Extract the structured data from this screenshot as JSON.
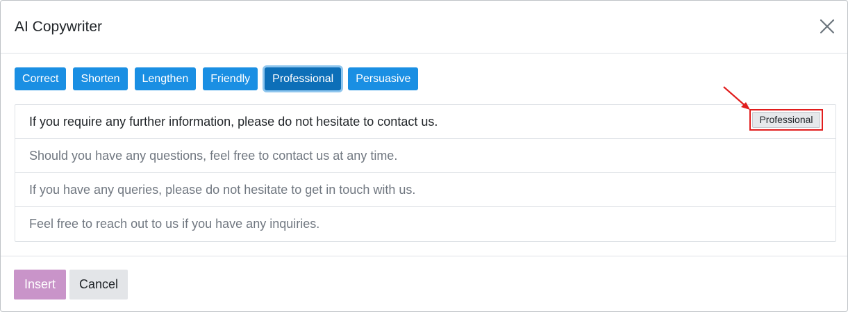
{
  "dialog": {
    "title": "AI Copywriter",
    "close_icon": "close-icon"
  },
  "toolbar": {
    "buttons": [
      {
        "label": "Correct",
        "active": false
      },
      {
        "label": "Shorten",
        "active": false
      },
      {
        "label": "Lengthen",
        "active": false
      },
      {
        "label": "Friendly",
        "active": false
      },
      {
        "label": "Professional",
        "active": true
      },
      {
        "label": "Persuasive",
        "active": false
      }
    ]
  },
  "suggestions": {
    "items": [
      {
        "text": "If you require any further information, please do not hesitate to contact us.",
        "selected": true,
        "tag": "Professional"
      },
      {
        "text": "Should you have any questions, feel free to contact us at any time.",
        "selected": false
      },
      {
        "text": "If you have any queries, please do not hesitate to get in touch with us.",
        "selected": false
      },
      {
        "text": "Feel free to reach out to us if you have any inquiries.",
        "selected": false
      }
    ]
  },
  "footer": {
    "insert_label": "Insert",
    "cancel_label": "Cancel"
  },
  "colors": {
    "tone_button": "#1a8fe3",
    "tone_button_active": "#0d6fb8",
    "insert_button": "#c994c9",
    "annotation": "#e11d1d"
  }
}
